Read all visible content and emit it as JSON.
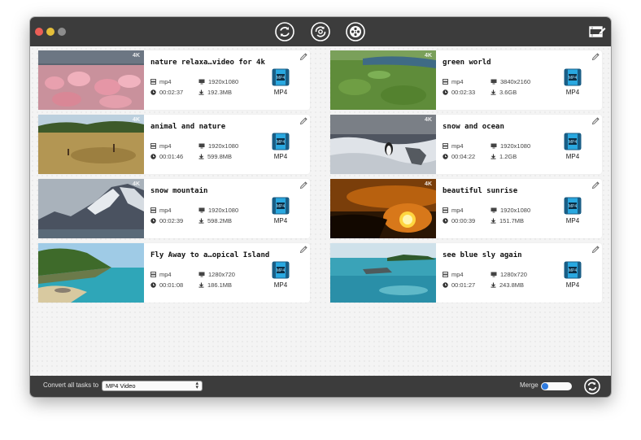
{
  "toolbar": {
    "tools": [
      {
        "name": "convert",
        "icon": "convert-icon",
        "active": true
      },
      {
        "name": "dvd",
        "icon": "dvd-rip-icon",
        "active": false
      },
      {
        "name": "media",
        "icon": "film-reel-icon",
        "active": false
      }
    ],
    "right_icon": "video-edit-icon"
  },
  "videos": [
    {
      "title": "nature relaxa…video for 4k",
      "format": "mp4",
      "resolution": "1920x1080",
      "duration": "00:02:37",
      "size": "192.3MB",
      "output": "MP4",
      "badge": "4K"
    },
    {
      "title": "green world",
      "format": "mp4",
      "resolution": "3840x2160",
      "duration": "00:02:33",
      "size": "3.6GB",
      "output": "MP4",
      "badge": "4K"
    },
    {
      "title": "animal and nature",
      "format": "mp4",
      "resolution": "1920x1080",
      "duration": "00:01:46",
      "size": "599.8MB",
      "output": "MP4",
      "badge": "4K"
    },
    {
      "title": "snow and  ocean",
      "format": "mp4",
      "resolution": "1920x1080",
      "duration": "00:04:22",
      "size": "1.2GB",
      "output": "MP4",
      "badge": "4K"
    },
    {
      "title": "snow mountain",
      "format": "mp4",
      "resolution": "1920x1080",
      "duration": "00:02:39",
      "size": "598.2MB",
      "output": "MP4",
      "badge": "4K"
    },
    {
      "title": "beautiful sunrise",
      "format": "mp4",
      "resolution": "1920x1080",
      "duration": "00:00:39",
      "size": "151.7MB",
      "output": "MP4",
      "badge": "4K"
    },
    {
      "title": "Fly Away to a…opical Island",
      "format": "mp4",
      "resolution": "1280x720",
      "duration": "00:01:08",
      "size": "186.1MB",
      "output": "MP4",
      "badge": ""
    },
    {
      "title": "see blue sly again",
      "format": "mp4",
      "resolution": "1280x720",
      "duration": "00:01:27",
      "size": "243.8MB",
      "output": "MP4",
      "badge": ""
    }
  ],
  "bottom": {
    "convert_all_label": "Convert all tasks to",
    "format_value": "MP4 Video",
    "merge_label": "Merge",
    "merge_on": false
  },
  "colors": {
    "titlebar": "#3c3c3c",
    "accent": "#2e7be0",
    "mp4_icon": "#29a8e0"
  }
}
